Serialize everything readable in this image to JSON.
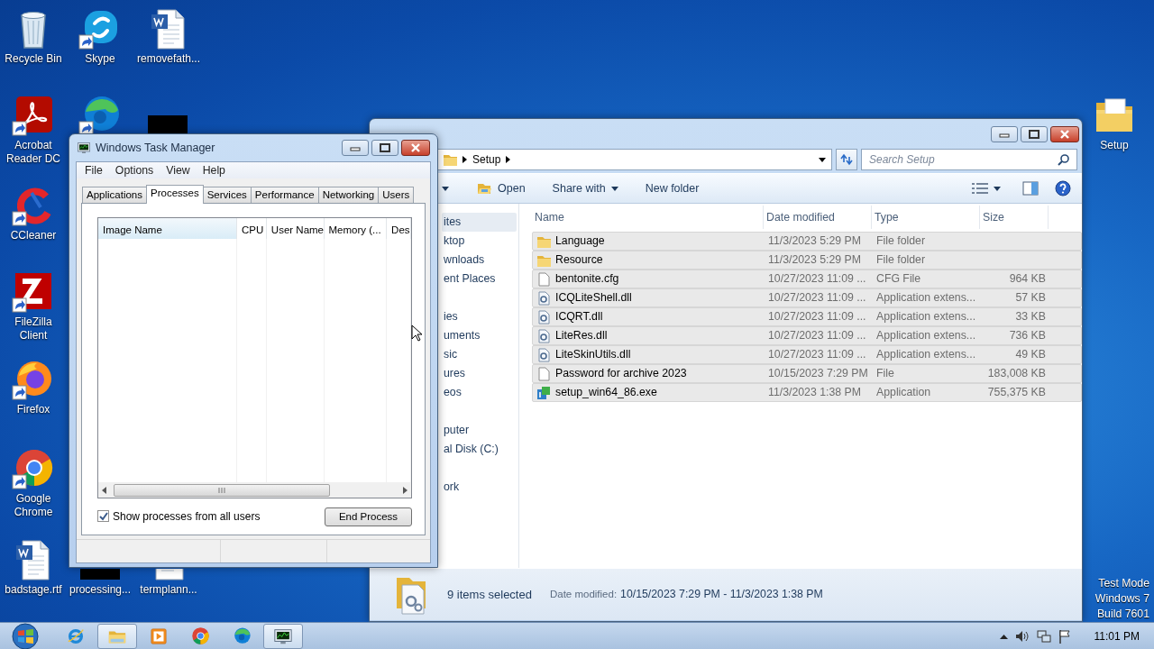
{
  "desktop_icons": [
    {
      "kind": "recycle-bin",
      "label": "Recycle Bin",
      "shortcut": false
    },
    {
      "kind": "skype",
      "label": "Skype",
      "shortcut": true
    },
    {
      "kind": "word-doc",
      "label": "removefath...",
      "shortcut": false
    },
    {
      "kind": "acrobat",
      "label": "Acrobat Reader DC",
      "shortcut": true
    },
    {
      "kind": "edge",
      "shortcut": true
    },
    {
      "kind": "dark"
    },
    {
      "kind": "ccleaner",
      "label": "CCleaner",
      "shortcut": true
    },
    {
      "kind": "filezilla",
      "label": "FileZilla Client",
      "shortcut": true
    },
    {
      "kind": "firefox",
      "label": "Firefox",
      "shortcut": true
    },
    {
      "kind": "chrome",
      "label": "Google Chrome",
      "shortcut": true
    },
    {
      "kind": "word-doc",
      "label": "badstage.rtf",
      "shortcut": false
    },
    {
      "kind": "dark",
      "label": "processing...",
      "shortcut": false
    },
    {
      "kind": "document",
      "label": "termplann...",
      "shortcut": false
    },
    {
      "kind": "folder",
      "label": "Setup",
      "shortcut": false
    }
  ],
  "explorer": {
    "address": [
      "Setup"
    ],
    "search": {
      "placeholder": "Search Setup"
    },
    "toolbar": [
      {
        "kind": "open",
        "label": "Open"
      },
      {
        "kind": "menu",
        "label": "Share with"
      },
      {
        "kind": "plain",
        "label": "New folder"
      }
    ],
    "nav_groups": [
      [
        {
          "label": "ites",
          "selected": true
        },
        {
          "label": "ktop",
          "selected": false
        },
        {
          "label": "wnloads",
          "selected": false
        },
        {
          "label": "ent Places",
          "selected": false
        }
      ],
      [
        {
          "label": "ies",
          "selected": false
        },
        {
          "label": "uments",
          "selected": false
        },
        {
          "label": "sic",
          "selected": false
        },
        {
          "label": "ures",
          "selected": false
        },
        {
          "label": "eos",
          "selected": false
        }
      ],
      [
        {
          "label": "puter",
          "selected": false
        },
        {
          "label": "al Disk (C:)",
          "selected": false
        }
      ],
      [
        {
          "label": "ork",
          "selected": false
        }
      ]
    ],
    "columns": [
      "Name",
      "Date modified",
      "Type",
      "Size"
    ],
    "files": [
      {
        "kind": "folder",
        "name": "Language",
        "date": "11/3/2023 5:29 PM",
        "type": "File folder",
        "selected": true
      },
      {
        "kind": "folder",
        "name": "Resource",
        "date": "11/3/2023 5:29 PM",
        "type": "File folder",
        "selected": true
      },
      {
        "kind": "file",
        "name": "bentonite.cfg",
        "date": "10/27/2023 11:09 ...",
        "type": "CFG File",
        "size": "964 KB",
        "selected": true
      },
      {
        "kind": "dll",
        "name": "ICQLiteShell.dll",
        "date": "10/27/2023 11:09 ...",
        "type": "Application extens...",
        "size": "57 KB",
        "selected": true
      },
      {
        "kind": "dll",
        "name": "ICQRT.dll",
        "date": "10/27/2023 11:09 ...",
        "type": "Application extens...",
        "size": "33 KB",
        "selected": true
      },
      {
        "kind": "dll",
        "name": "LiteRes.dll",
        "date": "10/27/2023 11:09 ...",
        "type": "Application extens...",
        "size": "736 KB",
        "selected": true
      },
      {
        "kind": "dll",
        "name": "LiteSkinUtils.dll",
        "date": "10/27/2023 11:09 ...",
        "type": "Application extens...",
        "size": "49 KB",
        "selected": true
      },
      {
        "kind": "file",
        "name": "Password for archive 2023",
        "date": "10/15/2023 7:29 PM",
        "type": "File",
        "size": "183,008 KB",
        "selected": true
      },
      {
        "kind": "exe",
        "name": "setup_win64_86.exe",
        "date": "11/3/2023 1:38 PM",
        "type": "Application",
        "size": "755,375 KB",
        "selected": true
      }
    ],
    "status": {
      "count": "9 items selected",
      "date_label": "Date modified:",
      "date_value": "10/15/2023 7:29 PM - 11/3/2023 1:38 PM"
    }
  },
  "task_manager": {
    "title": "Windows Task Manager",
    "menu": [
      "File",
      "Options",
      "View",
      "Help"
    ],
    "tabs": [
      {
        "label": "Applications",
        "selected": false
      },
      {
        "label": "Processes",
        "selected": true
      },
      {
        "label": "Services",
        "selected": false
      },
      {
        "label": "Performance",
        "selected": false
      },
      {
        "label": "Networking",
        "selected": false
      },
      {
        "label": "Users",
        "selected": false
      }
    ],
    "columns": [
      "Image Name",
      "CPU",
      "User Name",
      "Memory (...",
      "Des"
    ],
    "show_all": {
      "label": "Show processes from all users",
      "checked": true
    },
    "end_button": "End Process"
  },
  "desktop_text": [
    "Test Mode",
    "Windows 7",
    "Build 7601"
  ],
  "taskbar": {
    "apps": [
      {
        "kind": "ie",
        "active": false
      },
      {
        "kind": "explorer",
        "active": true
      },
      {
        "kind": "media",
        "active": false
      },
      {
        "kind": "chrome",
        "active": false
      },
      {
        "kind": "edge",
        "active": false
      },
      {
        "kind": "taskmgr",
        "active": true
      }
    ],
    "clock": "11:01 PM"
  }
}
